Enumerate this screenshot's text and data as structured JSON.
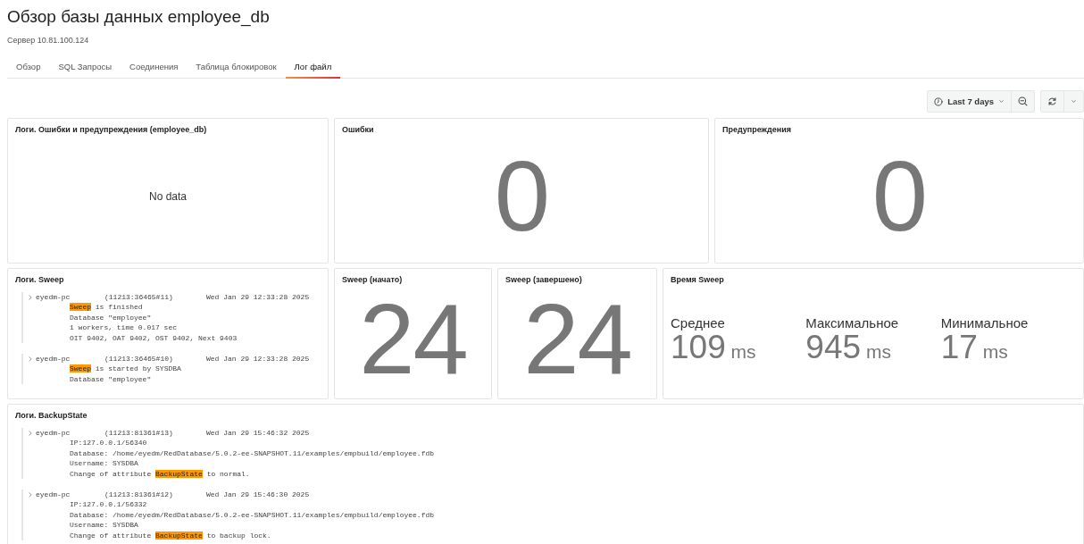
{
  "title": "Обзор базы данных employee_db",
  "subtitle": "Сервер 10.81.100.124",
  "tabs": [
    {
      "label": "Обзор",
      "selected": false
    },
    {
      "label": "SQL Запросы",
      "selected": false
    },
    {
      "label": "Соединения",
      "selected": false
    },
    {
      "label": "Таблица блокировок",
      "selected": false
    },
    {
      "label": "Лог файл",
      "selected": true
    }
  ],
  "toolbar": {
    "time_range": "Last 7 days"
  },
  "rows": [
    [
      {
        "kind": "nodata",
        "title": "Логи. Ошибки и предупреждения (employee_db)",
        "message": "No data"
      },
      {
        "kind": "stat",
        "title": "Ошибки",
        "value": "0"
      },
      {
        "kind": "stat",
        "title": "Предупреждения",
        "value": "0"
      }
    ],
    [
      {
        "kind": "logs",
        "title": "Логи. Sweep",
        "entries": [
          {
            "host": "eyedm-pc",
            "id": "(11213:36465#11)",
            "time": "Wed Jan 29 12:33:28 2025",
            "lines": [
              [
                {
                  "text": "Sweep",
                  "highlight": true
                },
                {
                  "text": " is finished",
                  "highlight": false
                }
              ],
              [
                {
                  "text": "Database \"employee\"",
                  "highlight": false
                }
              ],
              [
                {
                  "text": "1 workers, time 0.017 sec",
                  "highlight": false
                }
              ],
              [
                {
                  "text": "OIT 9402, OAT 9402, OST 9402, Next 9403",
                  "highlight": false
                }
              ]
            ]
          },
          {
            "host": "eyedm-pc",
            "id": "(11213:36465#10)",
            "time": "Wed Jan 29 12:33:28 2025",
            "lines": [
              [
                {
                  "text": "Sweep",
                  "highlight": true
                },
                {
                  "text": " is started by SYSDBA",
                  "highlight": false
                }
              ],
              [
                {
                  "text": "Database \"employee\"",
                  "highlight": false
                }
              ]
            ]
          }
        ]
      },
      {
        "kind": "stat",
        "title": "Sweep (начато)",
        "value": "24"
      },
      {
        "kind": "stat",
        "title": "Sweep (завершено)",
        "value": "24"
      },
      {
        "kind": "multistat",
        "title": "Время Sweep",
        "stats": [
          {
            "label": "Среднее",
            "value": "109",
            "unit": "ms"
          },
          {
            "label": "Максимальное",
            "value": "945",
            "unit": "ms"
          },
          {
            "label": "Минимальное",
            "value": "17",
            "unit": "ms"
          }
        ]
      }
    ],
    [
      {
        "kind": "logs",
        "title": "Логи. BackupState",
        "entries": [
          {
            "host": "eyedm-pc",
            "id": "(11213:81361#13)",
            "time": "Wed Jan 29 15:46:32 2025",
            "lines": [
              [
                {
                  "text": "IP:127.0.0.1/56340",
                  "highlight": false
                }
              ],
              [
                {
                  "text": "Database: /home/eyedm/RedDatabase/5.0.2-ee-SNAPSHOT.11/examples/empbuild/employee.fdb",
                  "highlight": false
                }
              ],
              [
                {
                  "text": "Username: SYSDBA",
                  "highlight": false
                }
              ],
              [
                {
                  "text": "Change of attribute ",
                  "highlight": false
                },
                {
                  "text": "BackupState",
                  "highlight": true
                },
                {
                  "text": " to normal.",
                  "highlight": false
                }
              ]
            ]
          },
          {
            "host": "eyedm-pc",
            "id": "(11213:81361#12)",
            "time": "Wed Jan 29 15:46:30 2025",
            "lines": [
              [
                {
                  "text": "IP:127.0.0.1/56332",
                  "highlight": false
                }
              ],
              [
                {
                  "text": "Database: /home/eyedm/RedDatabase/5.0.2-ee-SNAPSHOT.11/examples/empbuild/employee.fdb",
                  "highlight": false
                }
              ],
              [
                {
                  "text": "Username: SYSDBA",
                  "highlight": false
                }
              ],
              [
                {
                  "text": "Change of attribute ",
                  "highlight": false
                },
                {
                  "text": "BackupState",
                  "highlight": true
                },
                {
                  "text": " to backup lock.",
                  "highlight": false
                }
              ]
            ]
          }
        ]
      }
    ]
  ]
}
